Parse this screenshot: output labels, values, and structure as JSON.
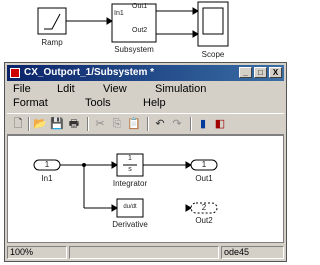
{
  "model": {
    "ramp_label": "Ramp",
    "subsystem_label": "Subsystem",
    "subsystem_ports": {
      "in1": "In1",
      "out1": "Out1",
      "out2": "Out2"
    },
    "scope_label": "Scope"
  },
  "window": {
    "title": "CX_Outport_1/Subsystem *",
    "controls": {
      "minimize": "_",
      "maximize": "□",
      "close": "X"
    },
    "menu": {
      "row1": [
        "File",
        "Ldit",
        "View",
        "Simulation"
      ],
      "row2": [
        "Format",
        "Tools",
        "Help"
      ]
    },
    "toolbar_icons": [
      "new-file-icon",
      "open-folder-icon",
      "save-icon",
      "print-icon",
      "cut-icon",
      "copy-icon",
      "paste-icon",
      "undo-icon",
      "redo-icon",
      "build-icon",
      "library-icon"
    ],
    "toolbar_glyphs": [
      "🗋",
      "📂",
      "💾",
      "🖶",
      "✂",
      "⎘",
      "📋",
      "↶",
      "↷",
      "▮",
      "◧"
    ]
  },
  "diagram": {
    "in1_number": "1",
    "in1_label": "In1",
    "integrator_symbol_top": "1",
    "integrator_symbol_bottom": "s",
    "integrator_label": "Integrator",
    "derivative_symbol": "du/dt",
    "derivative_label": "Derivative",
    "out1_number": "1",
    "out1_label": "Out1",
    "out2_number": "2",
    "out2_label": "Out2"
  },
  "status": {
    "zoom": "100%",
    "solver": "ode45"
  },
  "colors": {
    "title_bar": "#0a246a",
    "title_bar_end": "#3a6ea5",
    "window_face": "#d4d0c8"
  }
}
